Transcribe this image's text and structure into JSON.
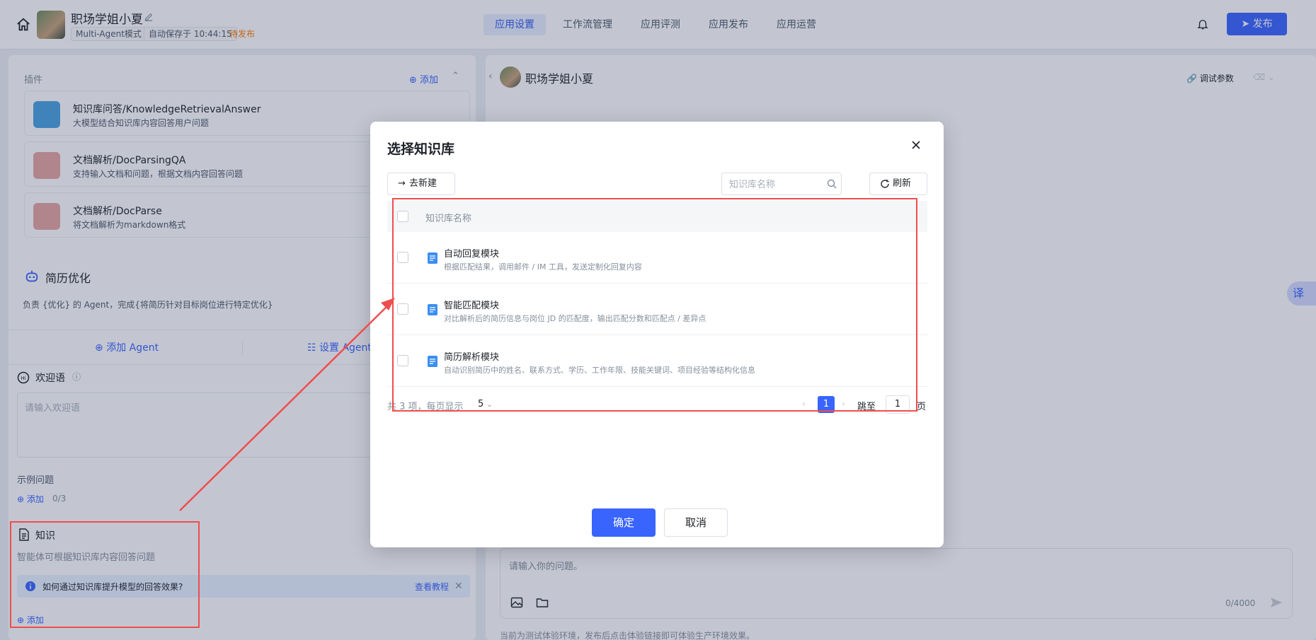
{
  "header": {
    "app_name": "职场学姐小夏",
    "mode": "Multi-Agent模式",
    "autosave": "自动保存于 10:44:15",
    "status": "待发布",
    "tabs": [
      "应用设置",
      "工作流管理",
      "应用评测",
      "应用发布",
      "应用运营"
    ],
    "active_tab": "应用设置",
    "publish_label": "发布"
  },
  "left": {
    "plugins_label": "插件",
    "plugins_add": "添加",
    "plugins": [
      {
        "title": "知识库问答/KnowledgeRetrievalAnswer",
        "desc": "大模型结合知识库内容回答用户问题"
      },
      {
        "title": "文档解析/DocParsingQA",
        "desc": "支持输入文档和问题，根据文档内容回答问题"
      },
      {
        "title": "文档解析/DocParse",
        "desc": "将文档解析为markdown格式"
      }
    ],
    "agent_title": "简历优化",
    "agent_desc": "负责 {优化} 的 Agent，完成{将简历针对目标岗位进行特定优化}",
    "add_agent": "添加 Agent",
    "set_agent": "设置 Agent",
    "welcome_title": "欢迎语",
    "welcome_placeholder": "请输入欢迎语",
    "examples_title": "示例问题",
    "examples_add": "添加",
    "examples_count": "0/3",
    "knowledge_title": "知识",
    "knowledge_desc": "智能体可根据知识库内容回答问题",
    "tip_text": "如何通过知识库提升模型的回答效果?",
    "tip_link": "查看教程",
    "knowledge_add": "添加"
  },
  "chat": {
    "name": "职场学姐小夏",
    "debug_label": "调试参数",
    "input_placeholder": "请输入你的问题。",
    "counter": "0/4000",
    "footer_note": "当前为测试体验环境，发布后点击体验链接即可体验生产环境效果。",
    "translate": "译"
  },
  "dialog": {
    "title": "选择知识库",
    "new_label": "去新建",
    "search_placeholder": "知识库名称",
    "refresh_label": "刷新",
    "column_name": "知识库名称",
    "rows": [
      {
        "name": "自动回复模块",
        "desc": "根据匹配结果，调用邮件 / IM 工具，发送定制化回复内容"
      },
      {
        "name": "智能匹配模块",
        "desc": "对比解析后的简历信息与岗位 JD 的匹配度，输出匹配分数和匹配点 / 差异点"
      },
      {
        "name": "简历解析模块",
        "desc": "自动识别简历中的姓名、联系方式、学历、工作年限、技能关键词、项目经验等结构化信息"
      }
    ],
    "total_text": "共 3 项，每页显示",
    "page_size": "5",
    "current_page": "1",
    "jump_label": "跳至",
    "jump_value": "1",
    "jump_suffix": "页",
    "ok_label": "确定",
    "cancel_label": "取消"
  },
  "colors": {
    "primary": "#3964fe",
    "annotation": "#f04d4d",
    "pending": "#ff7d00"
  }
}
